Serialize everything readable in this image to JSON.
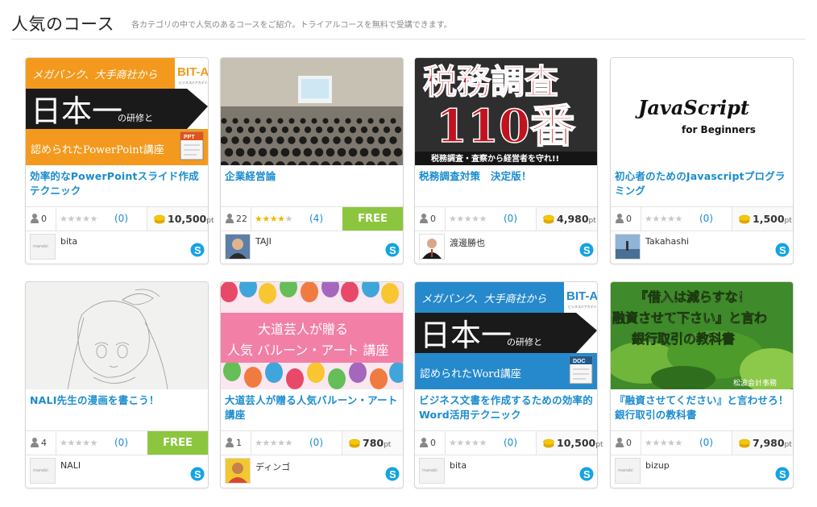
{
  "header": {
    "title": "人気のコース",
    "description": "各カテゴリの中で人気のあるコースをご紹介。トライアルコースを無料で受講できます。"
  },
  "courses": [
    {
      "thumb_text": [
        "メガバンク、大手商社から",
        "BIT-A",
        "日本一",
        "の研修と",
        "認められたPowerPoint講座",
        "PPT"
      ],
      "title": "効率的なPowerPointスライド作成テクニック",
      "users": "0",
      "stars": 0,
      "rating_count": "(0)",
      "price": "10,500",
      "price_unit": "pt",
      "free": false,
      "author": "bita",
      "avatar_text": "manebi"
    },
    {
      "thumb_text": [],
      "title": "企業経営論",
      "users": "22",
      "stars": 4,
      "rating_count": "(4)",
      "price": "",
      "price_unit": "",
      "free": true,
      "free_label": "FREE",
      "author": "TAJI",
      "avatar_text": ""
    },
    {
      "thumb_text": [
        "税務調査",
        "110番",
        "税務調査・査察から経営者を守れ!!"
      ],
      "title": "税務調査対策　決定版！",
      "users": "0",
      "stars": 0,
      "rating_count": "(0)",
      "price": "4,980",
      "price_unit": "pt",
      "free": false,
      "author": "渡邊勝也",
      "avatar_text": ""
    },
    {
      "thumb_text": [
        "JavaScript",
        "for Beginners"
      ],
      "title": "初心者のためのJavascriptプログラミング",
      "users": "0",
      "stars": 0,
      "rating_count": "(0)",
      "price": "1,500",
      "price_unit": "pt",
      "free": false,
      "author": "Takahashi",
      "avatar_text": ""
    },
    {
      "thumb_text": [],
      "title": "NALI先生の漫画を書こう！",
      "users": "4",
      "stars": 0,
      "rating_count": "(0)",
      "price": "",
      "price_unit": "",
      "free": true,
      "free_label": "FREE",
      "author": "NALI",
      "avatar_text": "manebi"
    },
    {
      "thumb_text": [
        "大道芸人が贈る",
        "人気 バルーン・アート 講座"
      ],
      "title": "大道芸人が贈る人気バルーン・アート講座",
      "users": "1",
      "stars": 0,
      "rating_count": "(0)",
      "price": "780",
      "price_unit": "pt",
      "free": false,
      "author": "ディンゴ",
      "avatar_text": ""
    },
    {
      "thumb_text": [
        "メガバンク、大手商社から",
        "BIT-A",
        "日本一",
        "の研修と",
        "認められたWord講座",
        "DOC"
      ],
      "title": "ビジネス文書を作成するための効率的Word活用テクニック",
      "users": "0",
      "stars": 0,
      "rating_count": "(0)",
      "price": "10,500",
      "price_unit": "pt",
      "free": false,
      "author": "bita",
      "avatar_text": "manebi"
    },
    {
      "thumb_text": [
        "『借入は減らすな！",
        "融資させて下さい』と言わ",
        "銀行取引の教科書",
        "松波会計事務"
      ],
      "title": "『融資させてください』と言わせろ！銀行取引の教科書",
      "users": "0",
      "stars": 0,
      "rating_count": "(0)",
      "price": "7,980",
      "price_unit": "pt",
      "free": false,
      "author": "bizup",
      "avatar_text": "manebi"
    }
  ],
  "colors": {
    "link": "#1a8ccf",
    "free": "#8cc63e",
    "star": "#f5b400",
    "coin": "#f2c200"
  },
  "icons": {
    "users": "person-icon",
    "price": "coin-icon",
    "contact": "skype-icon"
  }
}
